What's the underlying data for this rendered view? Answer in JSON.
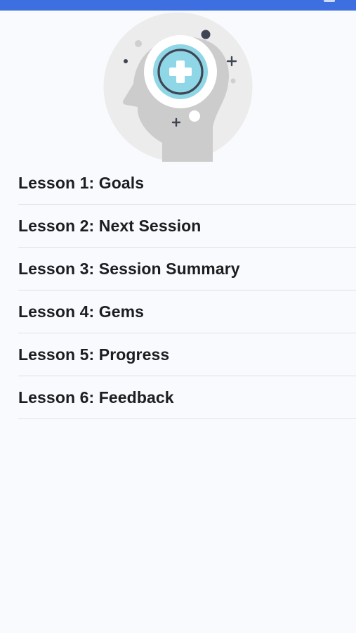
{
  "colors": {
    "status_bar": "#3e6fe0",
    "background": "#f8fafd",
    "divider": "#dfe1e4",
    "text": "#1d1d1f",
    "accent": "#7fd3e3"
  },
  "hero": {
    "icon": "head-with-medical-cross-icon"
  },
  "lessons": [
    {
      "label": "Lesson 1: Goals"
    },
    {
      "label": "Lesson 2: Next Session"
    },
    {
      "label": "Lesson 3: Session Summary"
    },
    {
      "label": "Lesson 4: Gems"
    },
    {
      "label": "Lesson 5: Progress"
    },
    {
      "label": "Lesson 6: Feedback"
    }
  ]
}
